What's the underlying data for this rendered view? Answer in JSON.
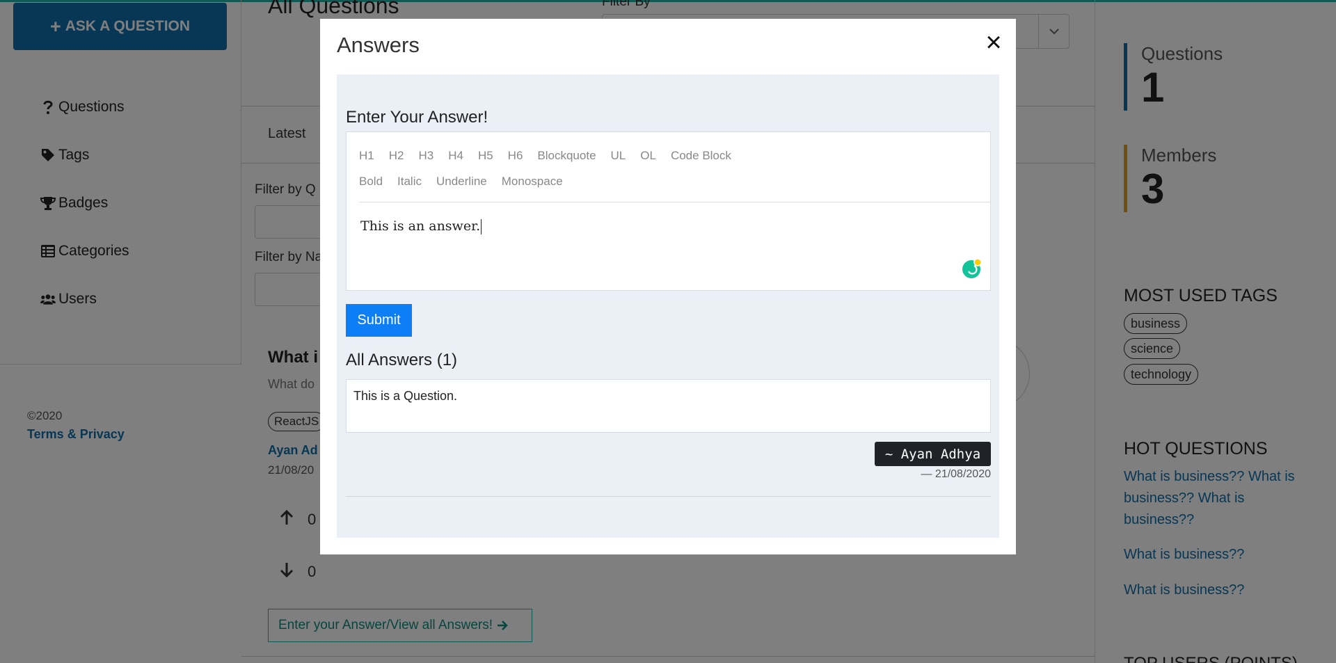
{
  "sidebar": {
    "ask_button": "ASK A QUESTION",
    "items": [
      {
        "label": "Questions",
        "icon": "question-icon"
      },
      {
        "label": "Tags",
        "icon": "tag-icon"
      },
      {
        "label": "Badges",
        "icon": "trophy-icon"
      },
      {
        "label": "Categories",
        "icon": "list-icon"
      },
      {
        "label": "Users",
        "icon": "users-icon"
      }
    ],
    "copyright": "©2020",
    "terms_link": "Terms & Privacy"
  },
  "main": {
    "title": "All Questions",
    "filter_by_label": "Filter By",
    "tab_latest": "Latest",
    "filter_question_label": "Filter by Q",
    "filter_name_label": "Filter by Na",
    "question": {
      "title": "What i",
      "description": "What do",
      "tag": "ReactJS",
      "author": "Ayan Ad",
      "date": "21/08/20",
      "upvotes": "0",
      "downvotes": "0"
    },
    "answer_link": "Enter your Answer/View all Answers!"
  },
  "right": {
    "stats": [
      {
        "label": "Questions",
        "value": "1",
        "color": "#0f6ea8"
      },
      {
        "label": "Members",
        "value": "3",
        "color": "#e0a020"
      }
    ],
    "most_used_tags_title": "MOST USED TAGS",
    "tags": [
      "business",
      "science",
      "technology"
    ],
    "hot_questions_title": "HOT QUESTIONS",
    "hot_questions": [
      "What is business?? What is business?? What is business??",
      "What is business??",
      "What is business??"
    ],
    "top_users_title": "TOP USERS (POINTS)"
  },
  "modal": {
    "title": "Answers",
    "close_symbol": "×",
    "enter_title": "Enter Your Answer!",
    "toolbar_row1": [
      "H1",
      "H2",
      "H3",
      "H4",
      "H5",
      "H6",
      "Blockquote",
      "UL",
      "OL",
      "Code Block"
    ],
    "toolbar_row2": [
      "Bold",
      "Italic",
      "Underline",
      "Monospace"
    ],
    "editor_text": "This is an answer.",
    "submit_label": "Submit",
    "all_answers_title": "All Answers (1)",
    "answers": [
      {
        "text": "This is a Question.",
        "author": "~ Ayan Adhya",
        "date": "— 21/08/2020"
      }
    ]
  },
  "colors": {
    "brand_blue": "#0f6ea8",
    "submit_blue": "#0d7ef5",
    "accent_teal": "#1fb6a6",
    "modal_body_bg": "#ebf0f7",
    "badge_dark": "#1f2328"
  }
}
